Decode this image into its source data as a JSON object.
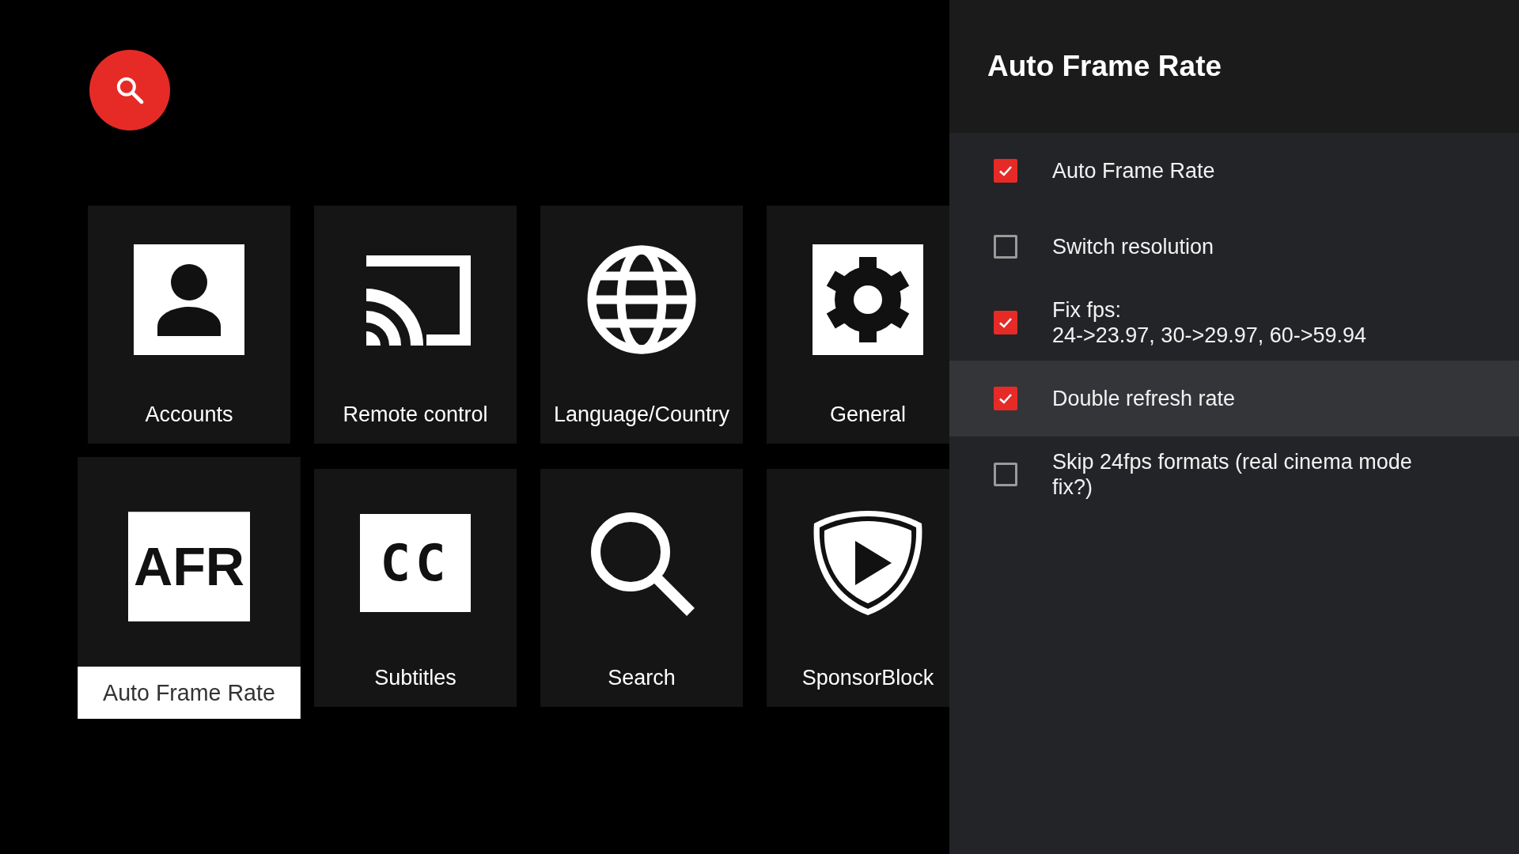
{
  "tiles": [
    {
      "label": "Accounts",
      "selected": false
    },
    {
      "label": "Remote control",
      "selected": false
    },
    {
      "label": "Language/Country",
      "selected": false
    },
    {
      "label": "General",
      "selected": false
    },
    {
      "label": "Auto Frame Rate",
      "icon_text": "AFR",
      "selected": true
    },
    {
      "label": "Subtitles",
      "icon_text": "CC",
      "selected": false
    },
    {
      "label": "Search",
      "selected": false
    },
    {
      "label": "SponsorBlock",
      "selected": false
    }
  ],
  "panel": {
    "title": "Auto Frame Rate",
    "options": [
      {
        "label": "Auto Frame Rate",
        "checked": true,
        "selected": false
      },
      {
        "label": "Switch resolution",
        "checked": false,
        "selected": false
      },
      {
        "label": "Fix fps:\n24->23.97, 30->29.97, 60->59.94",
        "checked": true,
        "selected": false
      },
      {
        "label": "Double refresh rate",
        "checked": true,
        "selected": true
      },
      {
        "label": "Skip 24fps formats (real cinema mode fix?)",
        "checked": false,
        "selected": false
      }
    ]
  }
}
